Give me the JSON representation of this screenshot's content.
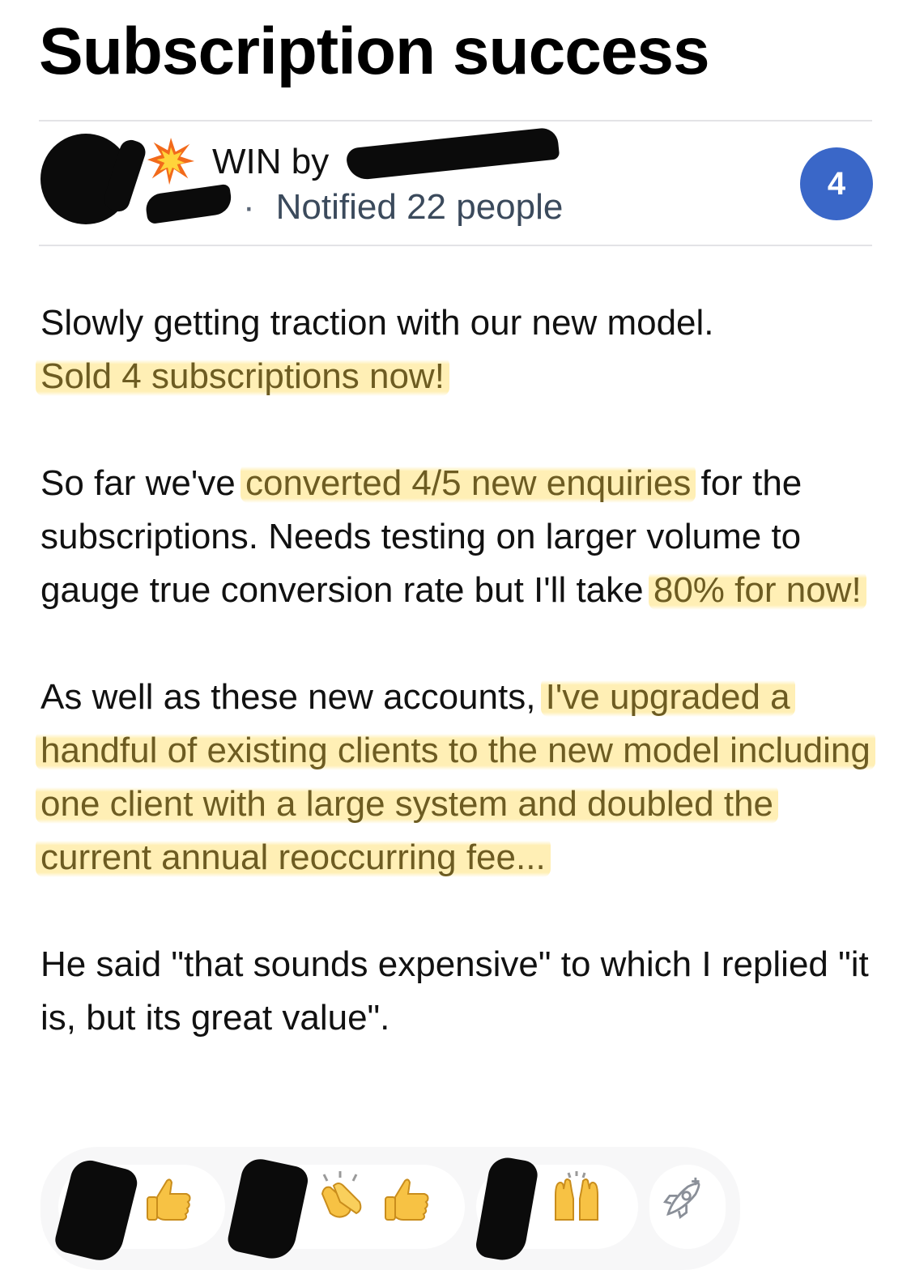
{
  "post": {
    "title": "Subscription success",
    "badge_count": "4",
    "header": {
      "win_label": "WIN by",
      "separator": "·",
      "notified": "Notified 22 people"
    },
    "paragraphs": {
      "p1_plain": "Slowly getting traction with our new model. ",
      "p1_highlight": "Sold 4 subscriptions now!",
      "p2_a": "So far we've ",
      "p2_highlight1": "converted 4/5 new enquiries",
      "p2_b": " for the subscriptions. Needs testing on larger volume to gauge true conversion rate but I'll take ",
      "p2_highlight2": "80% for now!",
      "p3_a": "As well as these new accounts, ",
      "p3_highlight": "I've upgraded a handful of existing clients to the new model including one client with a large system and doubled the current annual reoccurring fee...",
      "p4": "He said \"that sounds expensive\" to which I replied \"it is, but its great value\"."
    },
    "reactions": [
      {
        "emojis": [
          "thumbs-up-icon"
        ]
      },
      {
        "emojis": [
          "clapping-hands-icon",
          "thumbs-up-icon"
        ]
      },
      {
        "emojis": [
          "raising-hands-icon"
        ]
      }
    ],
    "add_reaction_icon": "rocket-add-icon",
    "colors": {
      "badge": "#3a67c8",
      "highlight": "#ffe278",
      "meta_text": "#3b4a5c"
    }
  }
}
